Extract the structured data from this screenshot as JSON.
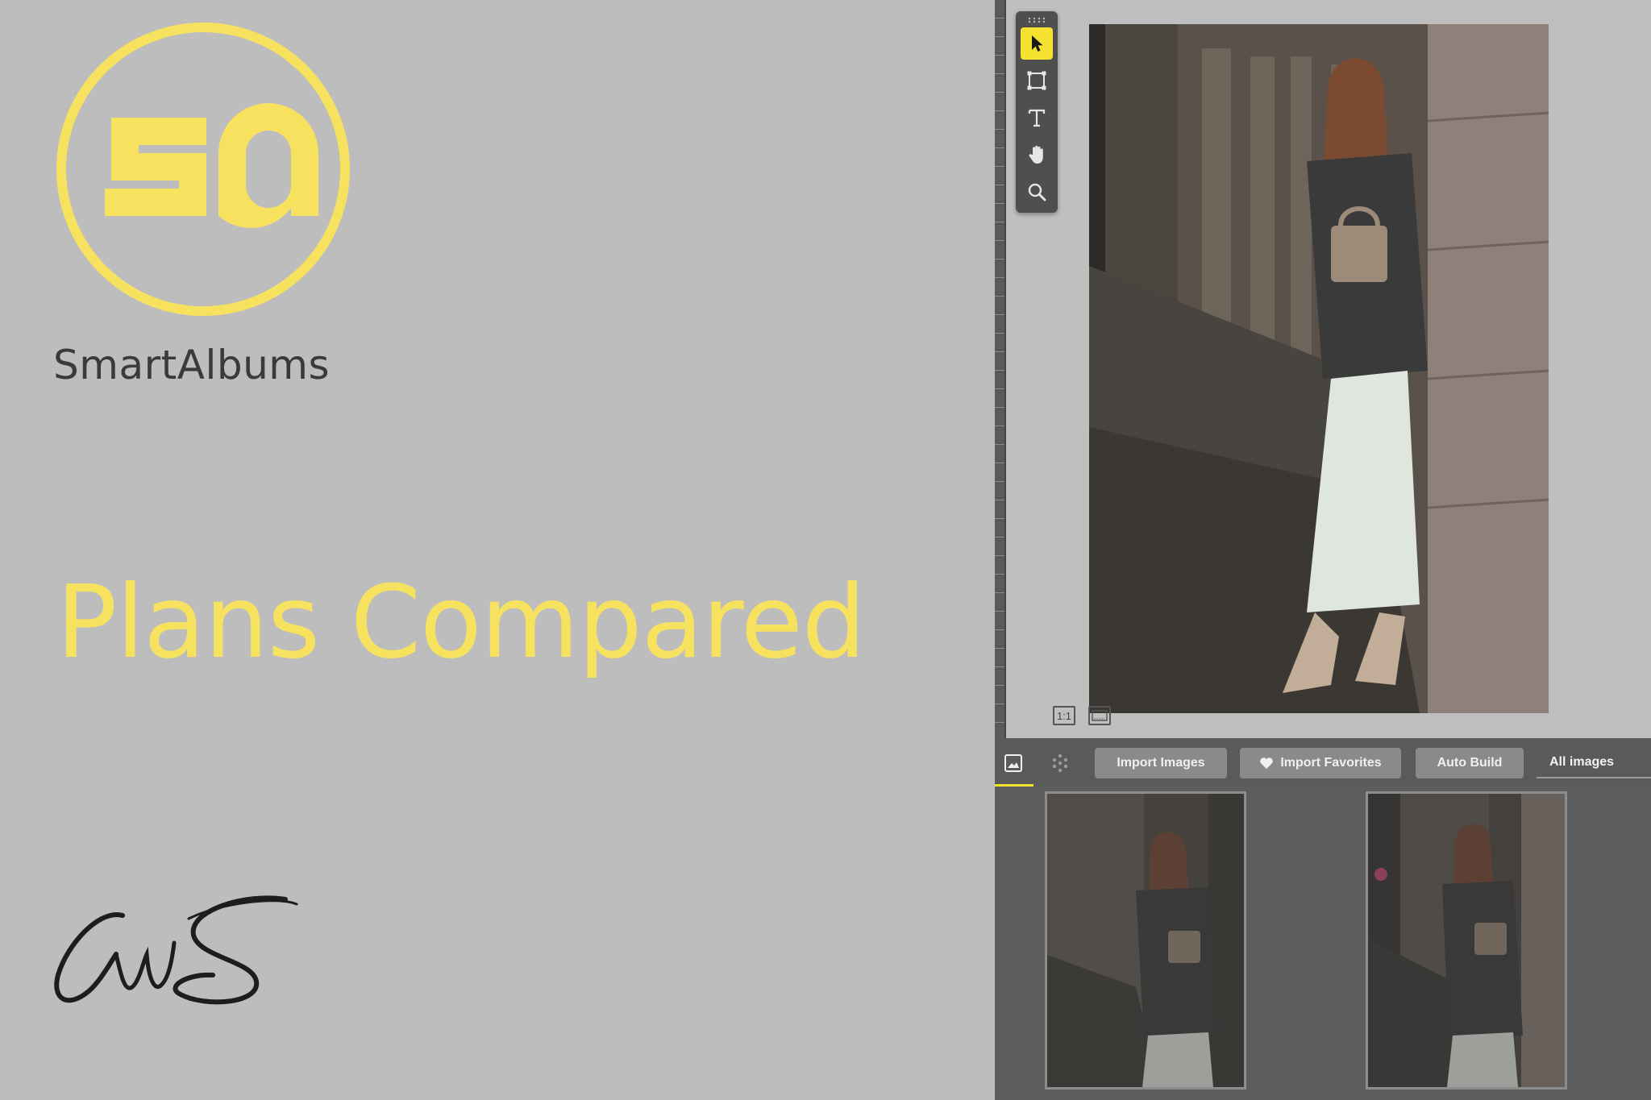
{
  "promo": {
    "brand_name": "SmartAlbums",
    "headline": "Plans Compared",
    "logo_letters": "sa",
    "signature_text": "CWS"
  },
  "colors": {
    "accent": "#f7e25f",
    "background": "#bdbdbd",
    "app_dark": "#5d5d5d"
  },
  "toolbar": {
    "tools": [
      {
        "name": "select",
        "icon": "cursor-arrow-icon",
        "active": true
      },
      {
        "name": "frame",
        "icon": "frame-crop-icon",
        "active": false
      },
      {
        "name": "text",
        "icon": "text-tool-icon",
        "active": false
      },
      {
        "name": "pan",
        "icon": "hand-icon",
        "active": false
      },
      {
        "name": "zoom",
        "icon": "magnifier-icon",
        "active": false
      }
    ]
  },
  "canvas": {
    "zoom_actual_label": "1:1"
  },
  "bottom_panel": {
    "tabs": [
      {
        "icon": "image-icon",
        "active": true
      },
      {
        "icon": "scatter-dots-icon",
        "active": false
      }
    ],
    "buttons": {
      "import_images": "Import Images",
      "import_favorites": "Import Favorites",
      "auto_build": "Auto Build"
    },
    "filter_selected": "All images"
  }
}
